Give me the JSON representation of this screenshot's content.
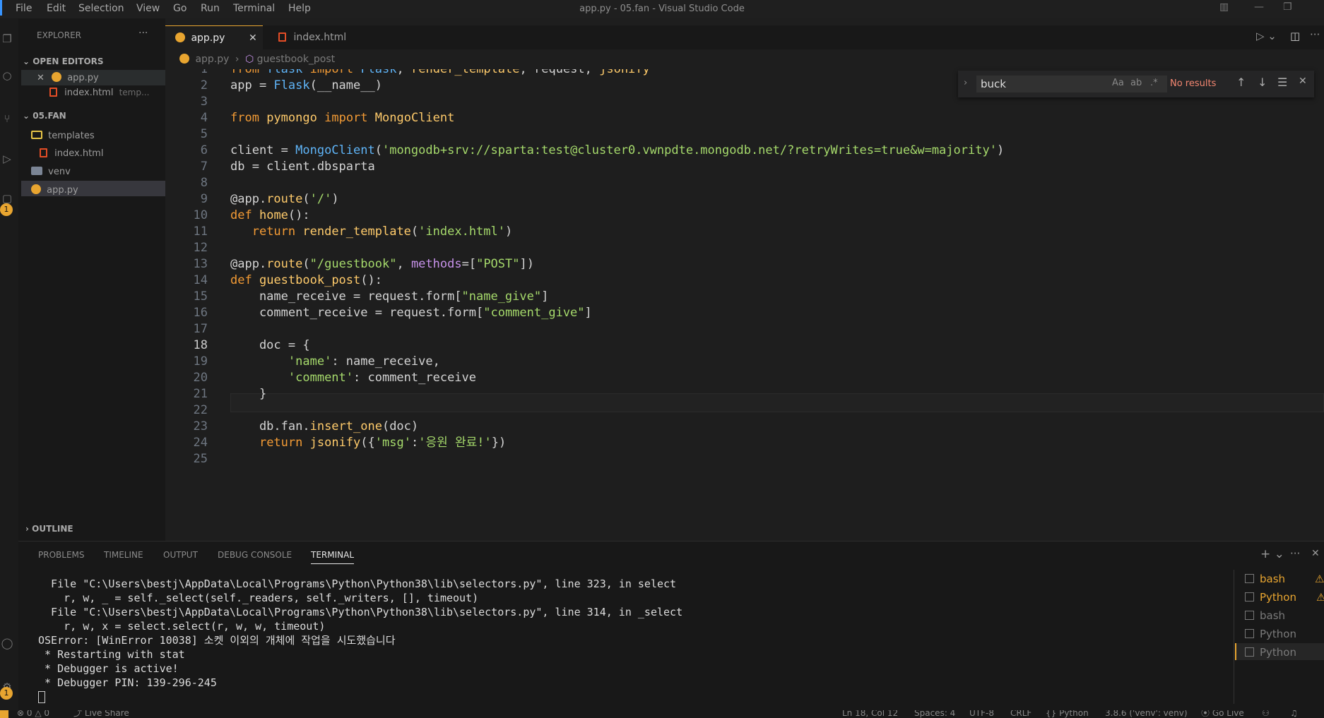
{
  "menu": [
    "File",
    "Edit",
    "Selection",
    "View",
    "Go",
    "Run",
    "Terminal",
    "Help"
  ],
  "window_title": "app.py - 05.fan - Visual Studio Code",
  "sidebar": {
    "title": "EXPLORER",
    "more": "···",
    "open_editors_label": "OPEN EDITORS",
    "open_editors": [
      {
        "name": "app.py",
        "icon": "python-file-icon",
        "detail": ""
      },
      {
        "name": "index.html",
        "icon": "html-file-icon",
        "detail": "temp..."
      }
    ],
    "folder_label": "05.FAN",
    "tree": [
      {
        "name": "templates",
        "icon": "folder-icon"
      },
      {
        "name": "index.html",
        "icon": "html-file-icon"
      },
      {
        "name": "venv",
        "icon": "folder-icon"
      },
      {
        "name": "app.py",
        "icon": "python-file-icon"
      }
    ],
    "outline_label": "OUTLINE",
    "badge": "1"
  },
  "tabs": [
    {
      "label": "app.py",
      "active": true
    },
    {
      "label": "index.html",
      "active": false
    }
  ],
  "breadcrumb": {
    "file": "app.py",
    "symbol": "guestbook_post"
  },
  "editor": {
    "line_numbers": [
      "1",
      "2",
      "3",
      "4",
      "5",
      "6",
      "7",
      "8",
      "9",
      "10",
      "11",
      "12",
      "13",
      "14",
      "15",
      "16",
      "17",
      "18",
      "19",
      "20",
      "21",
      "22",
      "23",
      "24",
      "25"
    ],
    "current_line": "18"
  },
  "find": {
    "value": "buck",
    "options": [
      "Aa",
      "ab",
      ".*"
    ],
    "status": "No results"
  },
  "panel": {
    "tabs": [
      "PROBLEMS",
      "TIMELINE",
      "OUTPUT",
      "DEBUG CONSOLE",
      "TERMINAL"
    ],
    "active_tab": "TERMINAL",
    "terminal_lines": [
      "  File \"C:\\Users\\bestj\\AppData\\Local\\Programs\\Python\\Python38\\lib\\selectors.py\", line 323, in select",
      "    r, w, _ = self._select(self._readers, self._writers, [], timeout)",
      "  File \"C:\\Users\\bestj\\AppData\\Local\\Programs\\Python\\Python38\\lib\\selectors.py\", line 314, in _select",
      "    r, w, x = select.select(r, w, w, timeout)",
      "OSError: [WinError 10038] 소켓 이외의 개체에 작업을 시도했습니다",
      " * Restarting with stat",
      " * Debugger is active!",
      " * Debugger PIN: 139-296-245"
    ],
    "terminals": [
      {
        "label": "bash",
        "color": "#e8a530"
      },
      {
        "label": "Python",
        "color": "#e8a530"
      },
      {
        "label": "bash",
        "color": "#7a7a7a"
      },
      {
        "label": "Python",
        "color": "#7a7a7a"
      },
      {
        "label": "Python",
        "color": "#7a7a7a"
      }
    ]
  },
  "statusbar": {
    "problems": "⊗ 0 △ 0",
    "live_share": "Live Share",
    "position": "Ln 18, Col 12",
    "spaces": "Spaces: 4",
    "encoding": "UTF-8",
    "eol": "CRLF",
    "language": "Python",
    "interpreter": "3.8.6 ('venv': venv)",
    "go_live": "Go Live"
  }
}
